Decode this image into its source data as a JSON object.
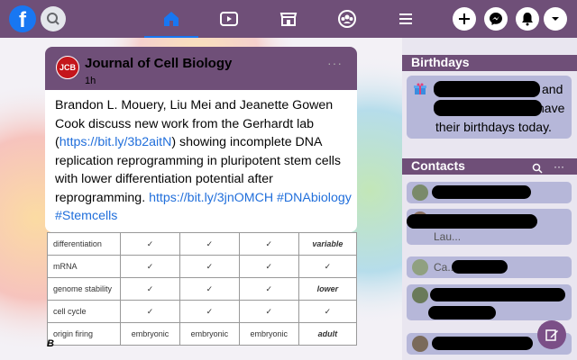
{
  "nav": {
    "logo": "f",
    "icons": [
      "home-icon",
      "watch-icon",
      "marketplace-icon",
      "groups-icon",
      "menu-icon"
    ],
    "actions": [
      "create-icon",
      "messenger-icon",
      "notifications-icon",
      "account-menu-icon"
    ]
  },
  "post": {
    "logo": "JCB",
    "author": "Journal of Cell Biology",
    "time": "1h",
    "more": "···",
    "text_1": "Brandon L. Mouery, Liu Mei  and Jeanette Gowen Cook discuss new work from the Gerhardt lab (",
    "link_1": "https://bit.ly/3b2aitN",
    "text_2": ") showing incomplete DNA replication reprogramming in pluripotent stem cells with lower differentiation potential after reprogramming. ",
    "link_2": "https://bit.ly/3jnOMCH",
    "tag_1": "#DNAbiology",
    "tag_2": "#Stemcells"
  },
  "table": {
    "rows": [
      {
        "label": "differentiation",
        "c1": "✓",
        "c2": "✓",
        "c3": "✓",
        "c4": "variable"
      },
      {
        "label": "mRNA",
        "c1": "✓",
        "c2": "✓",
        "c3": "✓",
        "c4": "✓"
      },
      {
        "label": "genome stability",
        "c1": "✓",
        "c2": "✓",
        "c3": "✓",
        "c4": "lower"
      },
      {
        "label": "cell cycle",
        "c1": "✓",
        "c2": "✓",
        "c3": "✓",
        "c4": "✓"
      },
      {
        "label": "origin firing",
        "c1": "embryonic",
        "c2": "embryonic",
        "c3": "embryonic",
        "c4": "adult"
      }
    ],
    "section_b": "B"
  },
  "sidebar": {
    "birthdays_title": "Birthdays",
    "bday_and": "and",
    "bday_have": "have",
    "bday_line3": "their birthdays today.",
    "contacts_title": "Contacts",
    "contacts_more": "···",
    "contact_fragments": [
      "Lau...",
      "Ca..."
    ]
  },
  "colors": {
    "brand": "#6f4f78",
    "facebook_blue": "#1877f2",
    "link": "#216fdb",
    "card": "#b6b7d9"
  }
}
